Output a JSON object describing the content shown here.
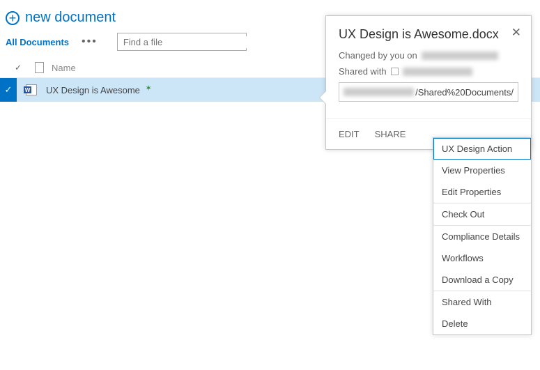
{
  "header": {
    "new_document_label": "new document"
  },
  "view": {
    "current_view": "All Documents",
    "search_placeholder": "Find a file"
  },
  "columns": {
    "name": "Name"
  },
  "document": {
    "title": "UX Design is Awesome",
    "filename": "UX Design is Awesome.docx"
  },
  "callout": {
    "changed_by_label": "Changed by you on",
    "shared_with_label": "Shared with",
    "url_visible_segment": "/Shared%20Documents/",
    "actions": {
      "edit": "EDIT",
      "share": "SHARE"
    }
  },
  "context_menu": {
    "items": [
      "UX Design Action",
      "View Properties",
      "Edit Properties",
      "Check Out",
      "Compliance Details",
      "Workflows",
      "Download a Copy",
      "Shared With",
      "Delete"
    ]
  }
}
